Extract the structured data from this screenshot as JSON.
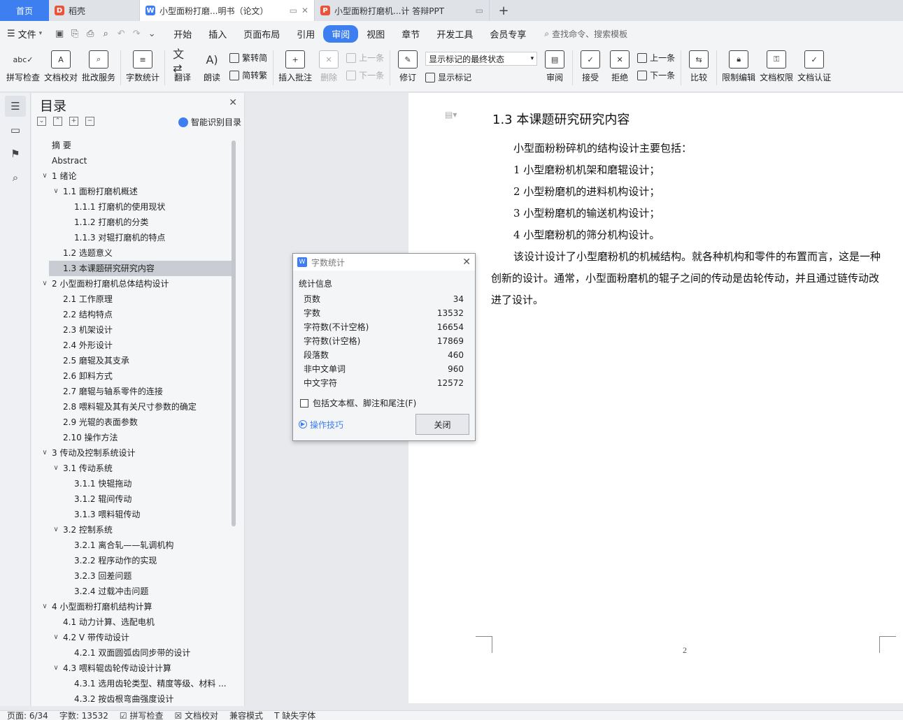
{
  "tabs": {
    "home": "首页",
    "items": [
      {
        "icon": "daoke-icon",
        "title": "稻壳",
        "color": "#e8543b"
      },
      {
        "icon": "wps-writer-icon",
        "title": "小型面粉打磨...明书（论文）",
        "color": "#3d7ff0",
        "active": true
      },
      {
        "icon": "wps-ppt-icon",
        "title": "小型面粉打磨机...计 答辩PPT",
        "color": "#e8543b"
      }
    ],
    "add": "+"
  },
  "menu": {
    "file": "文件",
    "items": [
      "开始",
      "插入",
      "页面布局",
      "引用",
      "审阅",
      "视图",
      "章节",
      "开发工具",
      "会员专享"
    ],
    "active": "审阅",
    "search": "查找命令、搜索模板"
  },
  "ribbon": {
    "spell": "拼写检查",
    "doc_check": "文档校对",
    "correction": "批改服务",
    "word_count": "字数统计",
    "translate": "翻译",
    "read_aloud": "朗读",
    "to_traditional": "繁转简",
    "to_simplified": "简转繁",
    "insert_comment": "插入批注",
    "delete": "删除",
    "prev_comment": "上一条",
    "next_comment": "下一条",
    "revise": "修订",
    "markup_state": "显示标记的最终状态",
    "show_markup": "显示标记",
    "review_pane": "审阅",
    "accept": "接受",
    "reject": "拒绝",
    "prev_change": "上一条",
    "next_change": "下一条",
    "compare": "比较",
    "restrict_edit": "限制编辑",
    "doc_permission": "文档权限",
    "doc_cert": "文档认证"
  },
  "toc": {
    "title": "目录",
    "ai_label": "智能识别目录",
    "items": [
      {
        "level": 0,
        "caret": "",
        "text": "摘    要"
      },
      {
        "level": 0,
        "caret": "",
        "text": "Abstract"
      },
      {
        "level": 0,
        "caret": "v",
        "text": "1 绪论"
      },
      {
        "level": 1,
        "caret": "v",
        "text": "1.1 面粉打磨机概述"
      },
      {
        "level": 2,
        "caret": "",
        "text": "1.1.1 打磨机的使用现状"
      },
      {
        "level": 2,
        "caret": "",
        "text": "1.1.2 打磨机的分类"
      },
      {
        "level": 2,
        "caret": "",
        "text": "1.1.3 对辊打磨机的特点"
      },
      {
        "level": 1,
        "caret": "",
        "text": "1.2 选题意义"
      },
      {
        "level": 1,
        "caret": "",
        "text": "1.3 本课题研究研究内容",
        "selected": true
      },
      {
        "level": 0,
        "caret": "v",
        "text": "2 小型面粉打磨机总体结构设计"
      },
      {
        "level": 1,
        "caret": "",
        "text": "2.1 工作原理"
      },
      {
        "level": 1,
        "caret": "",
        "text": "2.2 结构特点"
      },
      {
        "level": 1,
        "caret": "",
        "text": "2.3 机架设计"
      },
      {
        "level": 1,
        "caret": "",
        "text": "2.4 外形设计"
      },
      {
        "level": 1,
        "caret": "",
        "text": "2.5 磨辊及其支承"
      },
      {
        "level": 1,
        "caret": "",
        "text": "2.6 卸料方式"
      },
      {
        "level": 1,
        "caret": "",
        "text": "2.7 磨辊与轴系零件的连接"
      },
      {
        "level": 1,
        "caret": "",
        "text": "2.8 喂料辊及其有关尺寸参数的确定"
      },
      {
        "level": 1,
        "caret": "",
        "text": "2.9 光辊的表面参数"
      },
      {
        "level": 1,
        "caret": "",
        "text": "2.10 操作方法"
      },
      {
        "level": 0,
        "caret": "v",
        "text": "3 传动及控制系统设计"
      },
      {
        "level": 1,
        "caret": "v",
        "text": "3.1 传动系统"
      },
      {
        "level": 2,
        "caret": "",
        "text": "3.1.1 快辊拖动"
      },
      {
        "level": 2,
        "caret": "",
        "text": "3.1.2 辊间传动"
      },
      {
        "level": 2,
        "caret": "",
        "text": "3.1.3 喂料辊传动"
      },
      {
        "level": 1,
        "caret": "v",
        "text": "3.2 控制系统"
      },
      {
        "level": 2,
        "caret": "",
        "text": "3.2.1 离合轧——轧调机构"
      },
      {
        "level": 2,
        "caret": "",
        "text": "3.2.2 程序动作的实现"
      },
      {
        "level": 2,
        "caret": "",
        "text": "3.2.3 回差问题"
      },
      {
        "level": 2,
        "caret": "",
        "text": "3.2.4 过载冲击问题"
      },
      {
        "level": 0,
        "caret": "v",
        "text": "4 小型面粉打磨机结构计算"
      },
      {
        "level": 1,
        "caret": "",
        "text": "4.1 动力计算、选配电机"
      },
      {
        "level": 1,
        "caret": "v",
        "text": "4.2 V 带传动设计"
      },
      {
        "level": 2,
        "caret": "",
        "text": "4.2.1 双面圆弧齿同步带的设计"
      },
      {
        "level": 1,
        "caret": "v",
        "text": "4.3 喂料辊齿轮传动设计计算"
      },
      {
        "level": 2,
        "caret": "",
        "text": "4.3.1 选用齿轮类型、精度等级、材料 ..."
      },
      {
        "level": 2,
        "caret": "",
        "text": "4.3.2 按齿根弯曲强度设计"
      }
    ]
  },
  "document": {
    "heading": "1.3 本课题研究研究内容",
    "paragraphs": [
      "小型面粉粉碎机的结构设计主要包括：",
      "1 小型磨粉机机架和磨辊设计；",
      "2 小型粉磨机的进料机构设计；",
      "3 小型粉磨机的输送机构设计；",
      "4 小型磨粉机的筛分机构设计。",
      "该设计设计了小型磨粉机的机械结构。就各种机构和零件的布置而言，这是一种创新的设计。通常，小型面粉磨机的辊子之间的传动是齿轮传动，并且通过链传动改进了设计。"
    ],
    "page_number": "2"
  },
  "dialog": {
    "title": "字数统计",
    "section": "统计信息",
    "rows": [
      {
        "label": "页数",
        "value": "34"
      },
      {
        "label": "字数",
        "value": "13532"
      },
      {
        "label": "字符数(不计空格)",
        "value": "16654"
      },
      {
        "label": "字符数(计空格)",
        "value": "17869"
      },
      {
        "label": "段落数",
        "value": "460"
      },
      {
        "label": "非中文单词",
        "value": "960"
      },
      {
        "label": "中文字符",
        "value": "12572"
      }
    ],
    "checkbox": "包括文本框、脚注和尾注(F)",
    "tips": "操作技巧",
    "close": "关闭"
  },
  "status": {
    "page": "页面: 6/34",
    "words": "字数: 13532",
    "spell": "拼写检查",
    "proof": "文档校对",
    "compat": "兼容模式",
    "missing_font": "缺失字体"
  }
}
